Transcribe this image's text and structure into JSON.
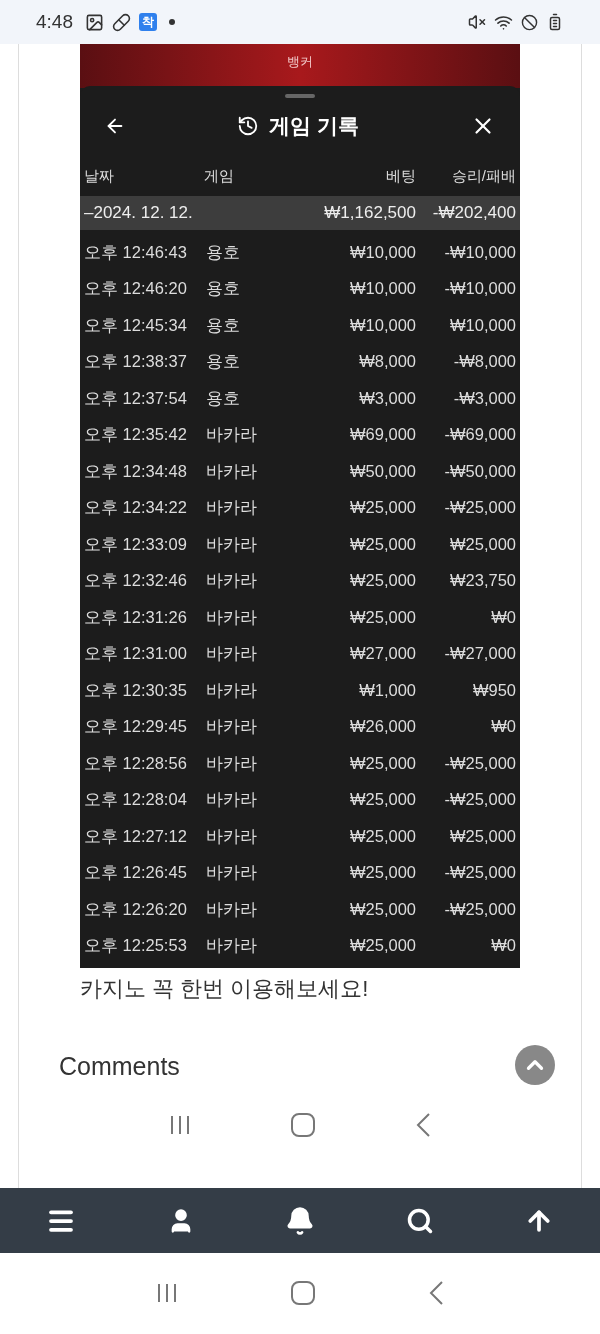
{
  "status_bar": {
    "time": "4:48",
    "app_badge": "착"
  },
  "game_banner": {
    "label": "뱅커"
  },
  "sheet": {
    "title": "게임 기록",
    "columns": [
      "날짜",
      "게임",
      "베팅",
      "승리/패배"
    ],
    "summary": {
      "date": "–2024. 12. 12.",
      "bet": "₩1,162,500",
      "result": "-₩202,400"
    },
    "rows": [
      {
        "time": "오후 12:46:43",
        "game": "용호",
        "bet": "₩10,000",
        "result": "-₩10,000"
      },
      {
        "time": "오후 12:46:20",
        "game": "용호",
        "bet": "₩10,000",
        "result": "-₩10,000"
      },
      {
        "time": "오후 12:45:34",
        "game": "용호",
        "bet": "₩10,000",
        "result": "₩10,000"
      },
      {
        "time": "오후 12:38:37",
        "game": "용호",
        "bet": "₩8,000",
        "result": "-₩8,000"
      },
      {
        "time": "오후 12:37:54",
        "game": "용호",
        "bet": "₩3,000",
        "result": "-₩3,000"
      },
      {
        "time": "오후 12:35:42",
        "game": "바카라",
        "bet": "₩69,000",
        "result": "-₩69,000"
      },
      {
        "time": "오후 12:34:48",
        "game": "바카라",
        "bet": "₩50,000",
        "result": "-₩50,000"
      },
      {
        "time": "오후 12:34:22",
        "game": "바카라",
        "bet": "₩25,000",
        "result": "-₩25,000"
      },
      {
        "time": "오후 12:33:09",
        "game": "바카라",
        "bet": "₩25,000",
        "result": "₩25,000"
      },
      {
        "time": "오후 12:32:46",
        "game": "바카라",
        "bet": "₩25,000",
        "result": "₩23,750"
      },
      {
        "time": "오후 12:31:26",
        "game": "바카라",
        "bet": "₩25,000",
        "result": "₩0"
      },
      {
        "time": "오후 12:31:00",
        "game": "바카라",
        "bet": "₩27,000",
        "result": "-₩27,000"
      },
      {
        "time": "오후 12:30:35",
        "game": "바카라",
        "bet": "₩1,000",
        "result": "₩950"
      },
      {
        "time": "오후 12:29:45",
        "game": "바카라",
        "bet": "₩26,000",
        "result": "₩0"
      },
      {
        "time": "오후 12:28:56",
        "game": "바카라",
        "bet": "₩25,000",
        "result": "-₩25,000"
      },
      {
        "time": "오후 12:28:04",
        "game": "바카라",
        "bet": "₩25,000",
        "result": "-₩25,000"
      },
      {
        "time": "오후 12:27:12",
        "game": "바카라",
        "bet": "₩25,000",
        "result": "₩25,000"
      },
      {
        "time": "오후 12:26:45",
        "game": "바카라",
        "bet": "₩25,000",
        "result": "-₩25,000"
      },
      {
        "time": "오후 12:26:20",
        "game": "바카라",
        "bet": "₩25,000",
        "result": "-₩25,000"
      },
      {
        "time": "오후 12:25:53",
        "game": "바카라",
        "bet": "₩25,000",
        "result": "₩0"
      }
    ]
  },
  "caption": "카지노 꼭 한번 이용해보세요!",
  "comments_heading": "Comments"
}
